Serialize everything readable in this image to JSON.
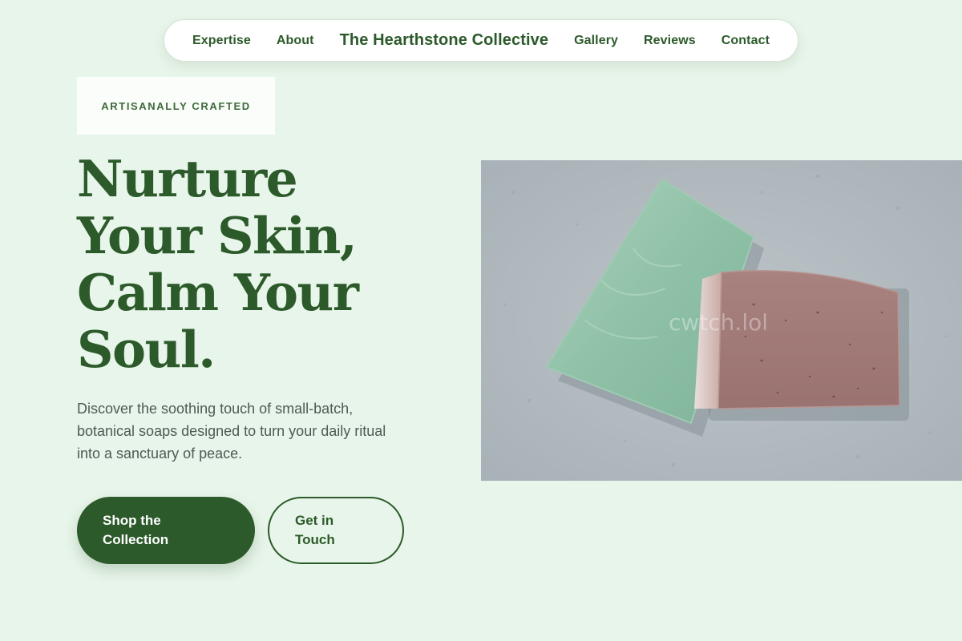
{
  "nav": {
    "links_left": [
      "Expertise",
      "About"
    ],
    "brand": "The Hearthstone Collective",
    "links_right": [
      "Gallery",
      "Reviews",
      "Contact"
    ]
  },
  "hero": {
    "badge": "ARTISANALLY CRAFTED",
    "headline_lines": [
      "Nurture",
      "Your Skin,",
      "Calm Your",
      "Soul."
    ],
    "subtext": "Discover the soothing touch of small-batch, botanical soaps designed to turn your daily ritual into a sanctuary of peace.",
    "primary_button": "Shop the Collection",
    "secondary_button": "Get in Touch",
    "image_watermark": "cwtch.lol"
  },
  "colors": {
    "background": "#e8f5ea",
    "brand_green": "#2c5a2a",
    "body_text": "#4f5a55",
    "badge_bg": "#fafdf9"
  }
}
